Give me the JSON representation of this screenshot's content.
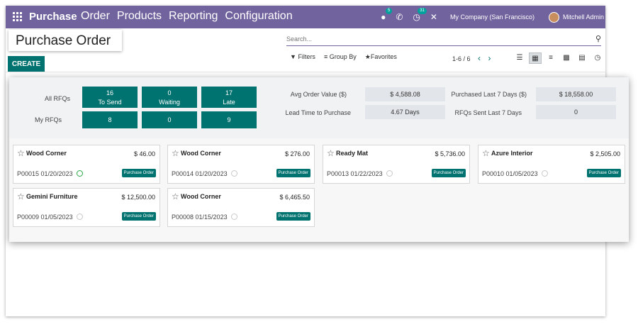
{
  "navbar": {
    "app_name": "Purchase",
    "menu": [
      "Order",
      "Products",
      "Reporting",
      "Configuration"
    ],
    "chat_count": "5",
    "activity_count": "31",
    "company": "My Company (San Francisco)",
    "user": "Mitchell Admin"
  },
  "page": {
    "title": "Purchase Order"
  },
  "search": {
    "placeholder": "Search..."
  },
  "toolbar": {
    "create_label": "CREATE",
    "filters_label": "Filters",
    "group_by_label": "Group By",
    "favorites_label": "Favorites",
    "pager": "1-6 / 6"
  },
  "dashboard": {
    "all_rfqs_label": "All RFQs",
    "my_rfqs_label": "My RFQs",
    "tiles": [
      {
        "count": "16",
        "label": "To Send",
        "my_count": "8"
      },
      {
        "count": "0",
        "label": "Waiting",
        "my_count": "0"
      },
      {
        "count": "17",
        "label": "Late",
        "my_count": "9"
      }
    ],
    "stats": [
      {
        "label": "Avg Order Value ($)",
        "value": "$ 4,588.08"
      },
      {
        "label": "Lead Time to Purchase",
        "value": "4.67  Days"
      },
      {
        "label": "Purchased Last 7 Days ($)",
        "value": "$ 18,558.00"
      },
      {
        "label": "RFQs Sent Last 7 Days",
        "value": "0"
      }
    ]
  },
  "orders": [
    {
      "vendor": "Wood Corner",
      "amount": "$ 46.00",
      "ref_date": "P00015 01/20/2023",
      "status": "Purchase Order"
    },
    {
      "vendor": "Wood Corner",
      "amount": "$ 276.00",
      "ref_date": "P00014 01/20/2023",
      "status": "Purchase Order"
    },
    {
      "vendor": "Ready Mat",
      "amount": "$ 5,736.00",
      "ref_date": "P00013 01/22/2023",
      "status": "Purchase Order"
    },
    {
      "vendor": "Azure Interior",
      "amount": "$ 2,505.00",
      "ref_date": "P00010 01/05/2023",
      "status": "Purchase Order"
    },
    {
      "vendor": "Gemini Furniture",
      "amount": "$ 12,500.00",
      "ref_date": "P00009 01/05/2023",
      "status": "Purchase Order"
    },
    {
      "vendor": "Wood Corner",
      "amount": "$ 6,465.50",
      "ref_date": "P00008 01/15/2023",
      "status": "Purchase Order"
    }
  ],
  "colors": {
    "navbar": "#71639e",
    "primary": "#00726f"
  }
}
